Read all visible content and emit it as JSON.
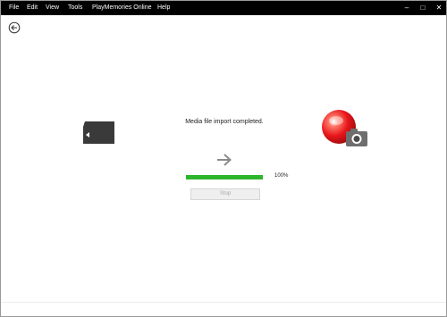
{
  "menu": {
    "items": [
      "File",
      "Edit",
      "View",
      "Tools",
      "PlayMemories Online",
      "Help"
    ]
  },
  "window_controls": {
    "minimize": "–",
    "maximize": "□",
    "close": "✕"
  },
  "import": {
    "status": "Media file import completed.",
    "progress_label": "100%",
    "progress_fraction": 1.0,
    "stop_label": "Stop"
  },
  "icons": {
    "back": "back-arrow-circle-icon",
    "source": "sd-card-icon",
    "transfer": "right-arrow-icon",
    "app": "playmemories-camera-icon"
  },
  "colors": {
    "menubar": "#000000",
    "progress": "#2db52d",
    "logo_red": "#e8161b"
  }
}
